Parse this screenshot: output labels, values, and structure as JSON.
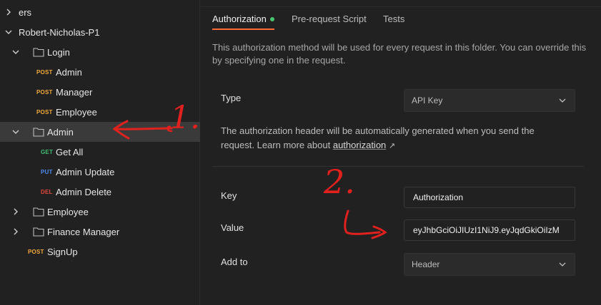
{
  "sidebar": {
    "items": [
      {
        "label": "ers"
      },
      {
        "label": "Robert-Nicholas-P1"
      },
      {
        "label": "Login"
      },
      {
        "method": "POST",
        "label": "Admin"
      },
      {
        "method": "POST",
        "label": "Manager"
      },
      {
        "method": "POST",
        "label": "Employee"
      },
      {
        "label": "Admin"
      },
      {
        "method": "GET",
        "label": "Get All"
      },
      {
        "method": "PUT",
        "label": "Admin Update"
      },
      {
        "method": "DEL",
        "label": "Admin Delete"
      },
      {
        "label": "Employee"
      },
      {
        "label": "Finance Manager"
      },
      {
        "method": "POST",
        "label": "SignUp"
      }
    ]
  },
  "main": {
    "tabs": [
      {
        "label": "Authorization"
      },
      {
        "label": "Pre-request Script"
      },
      {
        "label": "Tests"
      }
    ],
    "description": "This authorization method will be used for every request in this folder. You can override this by specifying one in the request.",
    "type_label": "Type",
    "type_value": "API Key",
    "info_text": "The authorization header will be automatically generated when you send the request. Learn more about",
    "info_link": "authorization",
    "info_link_arrow": "↗",
    "key_label": "Key",
    "key_value": "Authorization",
    "value_label": "Value",
    "value_value": "eyJhbGciOiJIUzI1NiJ9.eyJqdGkiOiIzM",
    "addto_label": "Add to",
    "addto_value": "Header"
  },
  "annotations": {
    "one": "1.",
    "two": "2."
  },
  "colors": {
    "accent": "#ff6c37",
    "post": "#f3a93a",
    "get": "#3fbf73",
    "put": "#4b8bf0",
    "del": "#e0483c",
    "annotation": "#e0211e",
    "status_dot": "#49c46e"
  }
}
